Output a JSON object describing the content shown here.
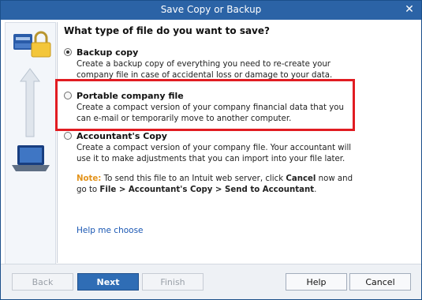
{
  "window": {
    "title": "Save Copy or Backup"
  },
  "heading": "What type of file do you want to save?",
  "options": [
    {
      "label": "Backup copy",
      "underlined": "u",
      "checked": true,
      "description": "Create a backup copy of everything you need to re-create your company file in case of accidental loss or damage to your data."
    },
    {
      "label": "Portable company file",
      "underlined": "P",
      "checked": false,
      "description": "Create a compact version of your company financial data that you can e-mail or temporarily move to another computer."
    },
    {
      "label": "Accountant's Copy",
      "underlined": "A",
      "checked": false,
      "description": "Create a compact version of your company file. Your accountant will use it to make adjustments that you can import into your file later."
    }
  ],
  "note": {
    "label": "Note:",
    "text_1": "To send this file to an Intuit web server, click",
    "cancel": "Cancel",
    "text_2": "now and go to",
    "path": "File > Accountant's Copy > Send to Accountant",
    "end": "."
  },
  "help_link": "Help me choose",
  "buttons": {
    "back": "Back",
    "next": "Next",
    "finish": "Finish",
    "help": "Help",
    "cancel": "Cancel"
  },
  "colors": {
    "titlebar": "#2b63a6",
    "highlight": "#e11c22",
    "link": "#1a57b3",
    "note_label": "#e3931b"
  },
  "icons": [
    "close-icon",
    "backup-drive-icon",
    "lock-icon",
    "arrow-up-icon",
    "laptop-icon"
  ]
}
